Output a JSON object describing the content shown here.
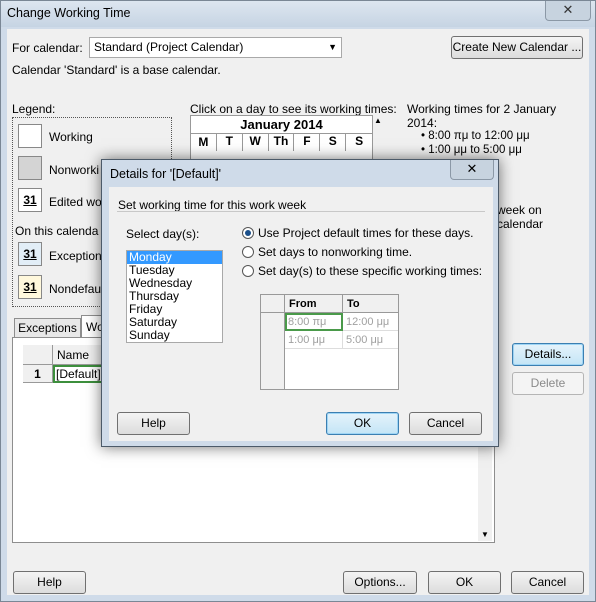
{
  "window": {
    "title": "Change Working Time",
    "close_glyph": "✕"
  },
  "calendar": {
    "for_label": "For calendar:",
    "selected": "Standard (Project Calendar)",
    "create_button": "Create New Calendar ...",
    "base_note": "Calendar 'Standard' is a base calendar."
  },
  "legend": {
    "title": "Legend:",
    "working": "Working",
    "nonworking": "Nonworki",
    "edited": "Edited wo",
    "on_this": "On this calenda",
    "exception": "Exception",
    "nondefault": "Nondefau",
    "day_number": "31"
  },
  "month": {
    "instruction": "Click on a day to see its working times:",
    "title": "January 2014",
    "days": [
      "M",
      "T",
      "W",
      "Th",
      "F",
      "S",
      "S"
    ]
  },
  "working_times": {
    "header": "Working times for 2 January 2014:",
    "lines": [
      "• 8:00 πμ to 12:00 μμ",
      "• 1:00 μμ to 5:00 μμ"
    ],
    "partial": "week on calendar"
  },
  "tabs": {
    "exceptions": "Exceptions",
    "work_weeks": "Wo"
  },
  "grid": {
    "header_name": "Name",
    "row_number": "1",
    "row_name": "[Default]"
  },
  "side_buttons": {
    "details": "Details...",
    "delete": "Delete"
  },
  "footer": {
    "help": "Help",
    "options": "Options...",
    "ok": "OK",
    "cancel": "Cancel"
  },
  "dialog": {
    "title": "Details for '[Default]'",
    "close_glyph": "✕",
    "group_label": "Set working time for this work week",
    "select_days_label": "Select day(s):",
    "days": [
      "Monday",
      "Tuesday",
      "Wednesday",
      "Thursday",
      "Friday",
      "Saturday",
      "Sunday"
    ],
    "radio_default": "Use Project default times for these days.",
    "radio_nonworking": "Set days to nonworking time.",
    "radio_specific": "Set day(s) to these specific working times:",
    "col_from": "From",
    "col_to": "To",
    "times": [
      {
        "from": "8:00 πμ",
        "to": "12:00 μμ"
      },
      {
        "from": "1:00 μμ",
        "to": "5:00 μμ"
      }
    ],
    "help": "Help",
    "ok": "OK",
    "cancel": "Cancel"
  }
}
